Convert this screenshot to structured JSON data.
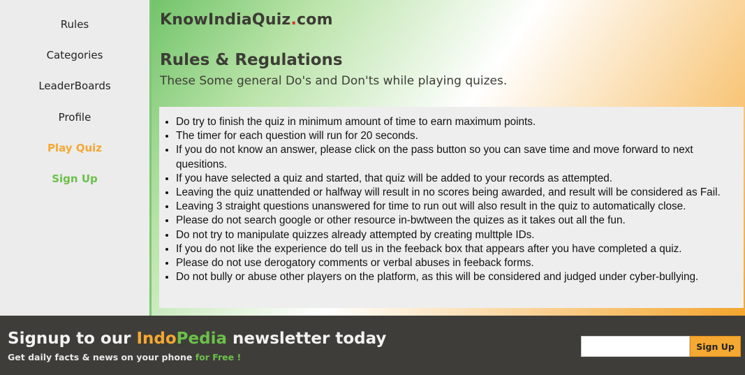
{
  "sidebar": {
    "items": [
      {
        "label": "Rules"
      },
      {
        "label": "Categories"
      },
      {
        "label": "LeaderBoards"
      },
      {
        "label": "Profile"
      },
      {
        "label": "Play Quiz"
      },
      {
        "label": "Sign Up"
      }
    ]
  },
  "header": {
    "brand_part1": "KnowIndiaQuiz",
    "brand_dot": ".",
    "brand_part2": "com"
  },
  "main": {
    "title": "Rules & Regulations",
    "subtitle": "These Some general Do's and Don'ts while playing quizes.",
    "rules": [
      "Do try to finish the quiz in minimum amount of time to earn maximum points.",
      "The timer for each question will run for 20 seconds.",
      "If you do not know an answer, please click on the pass button so you can save time and move forward to next quesitions.",
      "If you have selected a quiz and started, that quiz will be added to your records as attempted.",
      "Leaving the quiz unattended or halfway will result in no scores being awarded, and result will be considered as Fail.",
      "Leaving 3 straight questions unanswered for time to run out will also result in the quiz to automatically close.",
      "Please do not search google or other resource in-bwtween the quizes as it takes out all the fun.",
      "Do not try to manipulate quizzes already attempted by creating multtple IDs.",
      "If you do not like the experience do tell us in the feeback box that appears after you have completed a quiz.",
      "Please do not use derogatory comments or verbal abuses in feeback forms.",
      "Do not bully or abuse other players on the platform, as this will be considered and judged under cyber-bullying."
    ]
  },
  "footer": {
    "headline_pre": "Signup to our ",
    "headline_brand_a": "Indo",
    "headline_brand_b": "Pedia",
    "headline_post": " newsletter today",
    "tagline_pre": "Get daily facts & news on your phone ",
    "tagline_free": "for Free !",
    "input_value": "",
    "button_label": "Sign Up"
  },
  "colors": {
    "orange_accent": "#f5a832",
    "green_accent": "#6cc04a",
    "footer_bg": "#3f3d39",
    "sidebar_bg": "#ececec"
  }
}
